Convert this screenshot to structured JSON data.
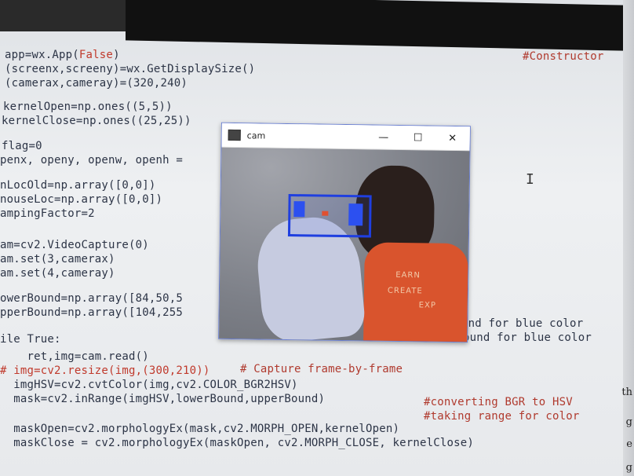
{
  "code_lines": [
    {
      "text": "app=wx.App(",
      "kw": "False",
      "rest": ")",
      "comment": "#Constructor"
    },
    {
      "text": "(screenx,screeny)=wx.GetDisplaySize()"
    },
    {
      "text": "(camerax,cameray)=(320,240)"
    },
    {
      "text": "kernelOpen=np.ones((5,5))"
    },
    {
      "text": "kernelClose=np.ones((25,25))"
    },
    {
      "text": "flag=0"
    },
    {
      "text": "penx, openy, openw, openh ="
    },
    {
      "text": "nLocOld=np.array([0,0])"
    },
    {
      "text": "nouseLoc=np.array([0,0])"
    },
    {
      "text": "ampingFactor=2"
    },
    {
      "text": "am=cv2.VideoCapture(0)"
    },
    {
      "text": "am.set(3,camerax)"
    },
    {
      "text": "am.set(4,cameray)"
    },
    {
      "text": "owerBound=np.array([84,50,5"
    },
    {
      "text": "pperBound=np.array([104,255"
    },
    {
      "text": "ile True:"
    },
    {
      "text": "    ret,img=cam.read()",
      "comment": "# Capture frame-by-frame"
    },
    {
      "text": "# img=cv2.resize(img,(300,210))"
    },
    {
      "text": "  imgHSV=cv2.cvtColor(img,cv2.COLOR_BGR2HSV)",
      "comment": "#converting BGR to HSV"
    },
    {
      "text": "  mask=cv2.inRange(imgHSV,lowerBound,upperBound)",
      "comment": "#taking range for color"
    },
    {
      "text": "  maskOpen=cv2.morphologyEx(mask,cv2.MORPH_OPEN,kernelOpen)"
    },
    {
      "text": "  maskClose = cv2.morphologyEx(maskOpen, cv2.MORPH_CLOSE, kernelClose)"
    }
  ],
  "tail_comments": {
    "lower": "und for blue color",
    "upper": "ound for blue color"
  },
  "right_edge_letters": [
    "th",
    "g",
    "e",
    "g"
  ],
  "cam_window": {
    "title": "cam",
    "minimize": "—",
    "maximize": "☐",
    "close": "✕",
    "shirt_line1": "EARN",
    "shirt_line2": "CREATE",
    "shirt_line3": "EXP"
  },
  "cursor_glyph": "I"
}
